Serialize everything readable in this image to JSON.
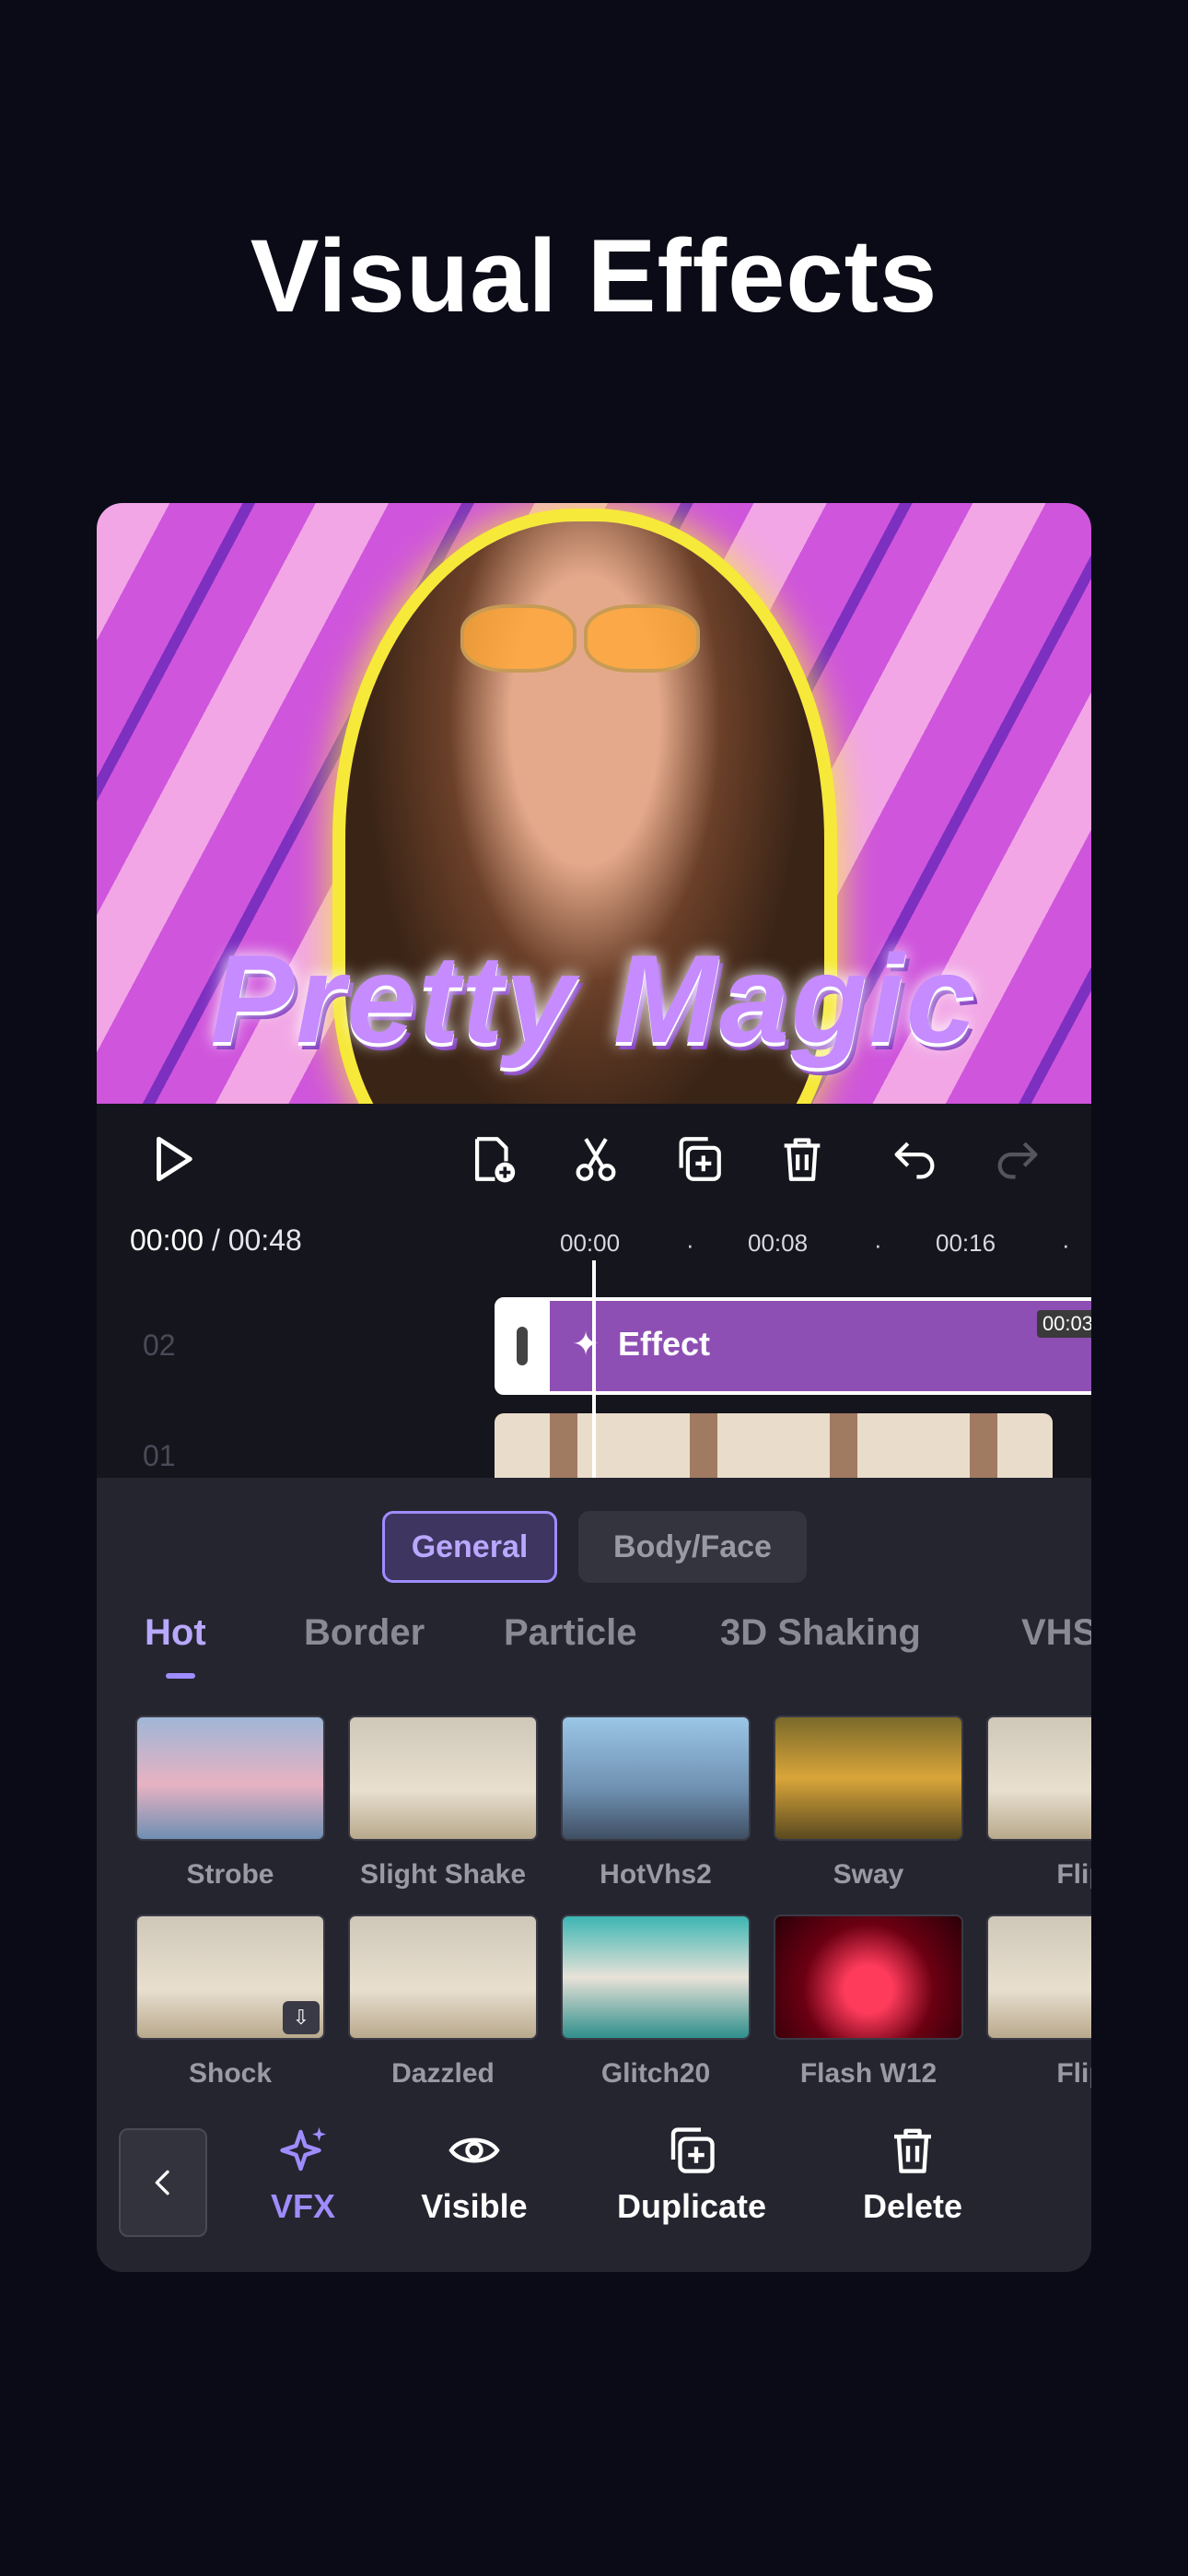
{
  "headline": "Visual Effects",
  "preview": {
    "overlay_text": "Pretty Magic"
  },
  "timeline": {
    "current_time": "00:00",
    "separator": " / ",
    "total_time": "00:48",
    "ticks": [
      "00:00",
      "00:08",
      "00:16"
    ],
    "tracks": [
      {
        "label": "02",
        "clip_label": "Effect",
        "clip_duration": "00:03"
      },
      {
        "label": "01"
      }
    ]
  },
  "toolbar": {
    "icons": [
      "play-icon",
      "add-clip-icon",
      "split-icon",
      "duplicate-icon",
      "trash-icon",
      "undo-icon",
      "redo-icon"
    ]
  },
  "panel": {
    "segments": [
      "General",
      "Body/Face"
    ],
    "categories": [
      "Hot",
      "Border",
      "Particle",
      "3D Shaking",
      "VHS"
    ],
    "effects_row1": [
      "Strobe",
      "Slight Shake",
      "HotVhs2",
      "Sway",
      "Flip"
    ],
    "effects_row2": [
      "Shock",
      "Dazzled",
      "Glitch20",
      "Flash W12",
      "Flip"
    ],
    "bottom_actions": [
      "VFX",
      "Visible",
      "Duplicate",
      "Delete"
    ]
  },
  "colors": {
    "accent": "#9f8cff",
    "clip": "#8e4fb4",
    "background": "#0b0b17"
  }
}
